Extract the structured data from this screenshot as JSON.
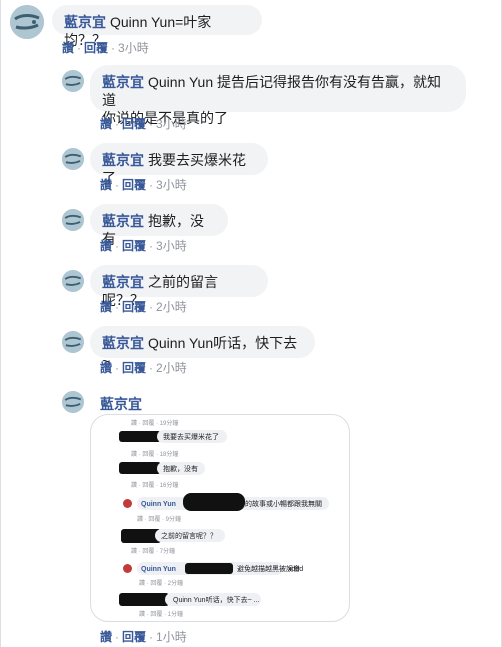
{
  "labels": {
    "like": "讚",
    "reply": "回覆",
    "sep": "·"
  },
  "comments": [
    {
      "author": "藍京宜",
      "text": "Quinn Yun=叶家均？？",
      "time": "3小時"
    },
    {
      "author": "藍京宜",
      "text_line1": "Quinn Yun 提告后记得报告你有没有告赢，就知道",
      "text_line2": "你说的是不是真的了",
      "time": "3小時"
    },
    {
      "author": "藍京宜",
      "text": "我要去买爆米花了",
      "time": "3小時"
    },
    {
      "author": "藍京宜",
      "text": "抱歉，没有",
      "time": "3小時"
    },
    {
      "author": "藍京宜",
      "text": "之前的留言呢？？",
      "time": "2小時"
    },
    {
      "author": "藍京宜",
      "text": "Quinn Yun听话，快下去~",
      "time": "2小時"
    },
    {
      "author": "藍京宜",
      "time": "1小時"
    }
  ],
  "attachment": {
    "rows": [
      {
        "meta": "讚 · 回覆 · 19分鐘"
      },
      {
        "text": "我要去买爆米花了",
        "meta": "讚 · 回覆 · 18分鐘"
      },
      {
        "text": "抱歉，没有",
        "meta": "讚 · 回覆 · 16分鐘"
      },
      {
        "name": "Quinn Yun",
        "text": "的故事或小暢都跟我無關",
        "meta": "讚 · 回覆 · 9分鐘"
      },
      {
        "text": "之前的留言呢？？",
        "meta": "讚 · 回覆 · 7分鐘"
      },
      {
        "name": "Quinn Yun",
        "text": "避免越描越黑被誤會",
        "extra": "xddd",
        "meta": "讚 · 回覆 · 2分鐘"
      },
      {
        "text": "Quinn Yun听话，快下去~ ...",
        "meta": "讚 · 回覆 · 1分鐘"
      }
    ]
  },
  "colors": {
    "link": "#385898",
    "bubble": "#f2f3f5",
    "meta": "#90949c",
    "avatar": "#b9cdd6"
  }
}
